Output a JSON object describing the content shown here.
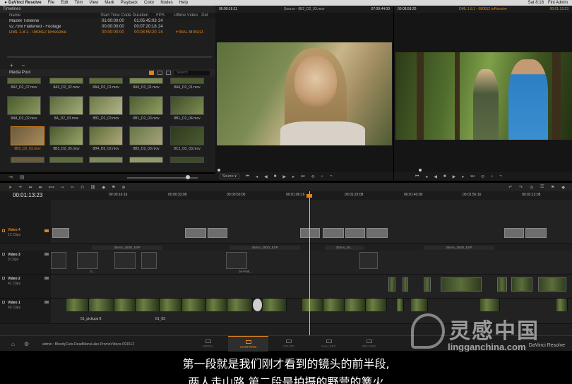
{
  "menubar": {
    "app": "DaVinci Resolve",
    "items": [
      "File",
      "Edit",
      "Trim",
      "View",
      "Mark",
      "Playback",
      "Color",
      "Nodes",
      "Help"
    ],
    "clock": "Sat 8:18",
    "user": "Fini Admin"
  },
  "timelines": {
    "title": "Timelines",
    "columns": [
      "Name",
      "Start Time Code",
      "Duration",
      "FPS",
      "Offline Video",
      "Det"
    ],
    "rows": [
      {
        "name": "Master Timeline",
        "start": "01:00:00:00",
        "duration": "01:05:45:03",
        "fps": "24",
        "offline": ""
      },
      {
        "name": "v2.79nl Flattened - Footage",
        "start": "00:00:00:00",
        "duration": "00:07:20:18",
        "fps": "24",
        "offline": ""
      },
      {
        "name": "DML 1.8.1 - 080812 toResolve",
        "start": "00:00:00:00",
        "duration": "00:08:59:20",
        "fps": "24",
        "offline": "FINAL MIXDO..."
      }
    ]
  },
  "media_pool": {
    "title": "Media Pool",
    "search_placeholder": "Search",
    "add": "+",
    "remove": "−",
    "clips_row0": [
      "8A2_D2_07.mov",
      "8A3_D2_02.mov",
      "8A4_D2_01.mov",
      "8A5_D2_01.mov",
      "8A6_D2_01.mov"
    ],
    "clips_row1": [
      "8A8_D2_02.mov",
      "8A_D2_03.mov",
      "8B1_D2_03.mov",
      "8B1_D2_03.mov",
      "8B1_D2_04.mov"
    ],
    "clips_row2": [
      "8B2_D2_03.mov",
      "8B3_D2_05.mov",
      "8B4_D2_02.mov",
      "8B5_D2_03.mov",
      "8C1_D2_03.mov"
    ]
  },
  "source_viewer": {
    "timecode_left": "00:00:16:11",
    "title": "Source - 8B2_D2_03.mov",
    "timecode_right": "07:00:44:00",
    "source_select": "Source"
  },
  "record_viewer": {
    "timecode_left": "00:08:59:20",
    "title": "DML 1.8.1 - 080812 toResolve",
    "timecode_right": "00:01:13:23"
  },
  "timeline": {
    "current_tc": "00:01:13:23",
    "ruler_ticks": [
      "00:00:16:16",
      "00:00:33:08",
      "00:00:50:00",
      "00:01:06:16",
      "00:01:23:08",
      "00:01:40:00",
      "00:01:56:16",
      "00:02:13:08"
    ],
    "tracks": [
      {
        "name": "Video 4",
        "clips": "13 Clips"
      },
      {
        "name": "Video 3",
        "clips": "9 Clips"
      },
      {
        "name": "Video 2",
        "clips": "41 Clips"
      },
      {
        "name": "Video 1",
        "clips": "60 Clips"
      }
    ],
    "v3_labels": [
      "35mm_250D_EXP",
      "35mm_250D_EXP",
      "35mm_25...",
      "35mm_250D_EXP"
    ],
    "v3_clip_labels": [
      "0...",
      "04-Feat..."
    ],
    "v1_labels": [
      "01_pickups 8",
      "01_03"
    ]
  },
  "bottom": {
    "project": "admin : BloodyCuts-DeadMansLake-PromoVideos-091512",
    "pages": [
      "MEDIA",
      "CONFORM",
      "COLOR",
      "GALLERY",
      "DELIVER"
    ],
    "active_page": "CONFORM",
    "brand": "DaVinci Resolve"
  },
  "watermark": {
    "title": "灵感中国",
    "url": "lingganchina.com"
  },
  "subtitles": {
    "line1": "第一段就是我们刚才看到的镜头的前半段,",
    "line2": "两人走山路,第二段是拍摄的野营的篝火"
  },
  "colors": {
    "accent": "#e0861c",
    "panel": "#1e1e1e"
  }
}
